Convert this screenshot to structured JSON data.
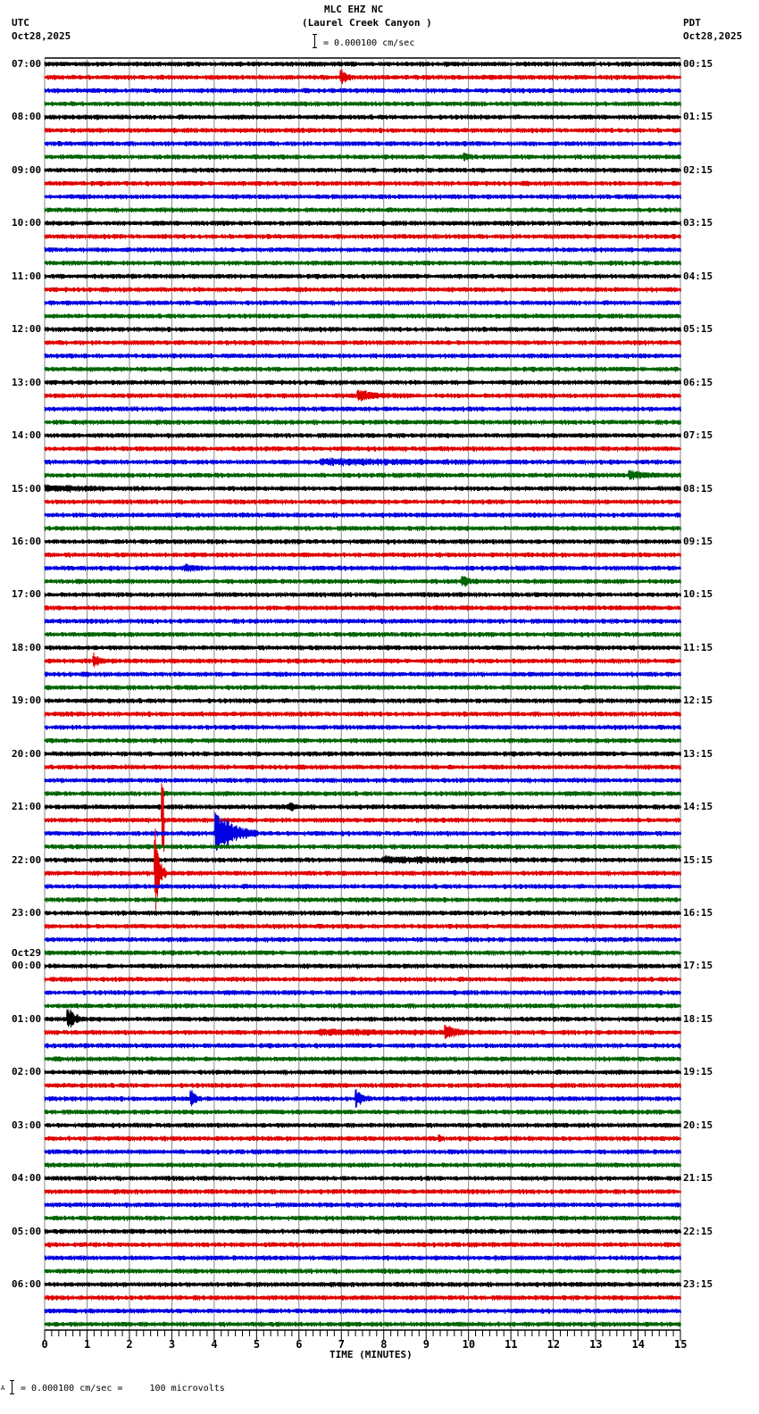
{
  "header": {
    "station": "MLC EHZ NC",
    "location": "(Laurel Creek Canyon )",
    "left_zone": "UTC",
    "left_date": "Oct28,2025",
    "right_zone": "PDT",
    "right_date": "Oct28,2025",
    "scale": "= 0.000100 cm/sec"
  },
  "footer": {
    "scale": "= 0.000100 cm/sec =     100 microvolts",
    "marker": "A"
  },
  "chart_data": {
    "type": "line",
    "title": "MLC EHZ NC (Laurel Creek Canyon )",
    "xlabel": "TIME (MINUTES)",
    "xlim": [
      0,
      15
    ],
    "x_ticks": [
      "0",
      "1",
      "2",
      "3",
      "4",
      "5",
      "6",
      "7",
      "8",
      "9",
      "10",
      "11",
      "12",
      "13",
      "14",
      "15"
    ],
    "traces_per_hour": 4,
    "trace_count": 96,
    "trace_colors": [
      "#000000",
      "#e00000",
      "#0000e0",
      "#006400"
    ],
    "left_labels": [
      "07:00",
      "08:00",
      "09:00",
      "10:00",
      "11:00",
      "12:00",
      "13:00",
      "14:00",
      "15:00",
      "16:00",
      "17:00",
      "18:00",
      "19:00",
      "20:00",
      "21:00",
      "22:00",
      "23:00",
      "00:00",
      "01:00",
      "02:00",
      "03:00",
      "04:00",
      "05:00",
      "06:00"
    ],
    "date_change_label": "Oct29",
    "right_labels": [
      "00:15",
      "01:15",
      "02:15",
      "03:15",
      "04:15",
      "05:15",
      "06:15",
      "07:15",
      "08:15",
      "09:15",
      "10:15",
      "11:15",
      "12:15",
      "13:15",
      "14:15",
      "15:15",
      "16:15",
      "17:15",
      "18:15",
      "19:15",
      "20:15",
      "21:15",
      "22:15",
      "23:15"
    ],
    "noise_level": 2.2,
    "events": [
      {
        "trace": 1,
        "minute": 7.0,
        "amplitude": 8,
        "duration": 0.3
      },
      {
        "trace": 7,
        "minute": 9.9,
        "amplitude": 4,
        "duration": 0.3
      },
      {
        "trace": 25,
        "minute": 7.4,
        "amplitude": 6,
        "duration": 1.0
      },
      {
        "trace": 30,
        "minute": 6.5,
        "amplitude": 3,
        "duration": 5.5
      },
      {
        "trace": 31,
        "minute": 13.8,
        "amplitude": 4,
        "duration": 1.2
      },
      {
        "trace": 32,
        "minute": 0.0,
        "amplitude": 3,
        "duration": 2.5
      },
      {
        "trace": 38,
        "minute": 3.3,
        "amplitude": 4,
        "duration": 0.6
      },
      {
        "trace": 39,
        "minute": 9.85,
        "amplitude": 7,
        "duration": 0.4
      },
      {
        "trace": 45,
        "minute": 1.15,
        "amplitude": 8,
        "duration": 0.3
      },
      {
        "trace": 56,
        "minute": 5.8,
        "amplitude": 5,
        "duration": 0.2
      },
      {
        "trace": 57,
        "minute": 2.77,
        "amplitude": 60,
        "duration": 0.05
      },
      {
        "trace": 58,
        "minute": 4.05,
        "amplitude": 30,
        "duration": 1.0
      },
      {
        "trace": 60,
        "minute": 8.0,
        "amplitude": 3,
        "duration": 4.8
      },
      {
        "trace": 61,
        "minute": 2.62,
        "amplitude": 60,
        "duration": 0.25
      },
      {
        "trace": 72,
        "minute": 0.55,
        "amplitude": 16,
        "duration": 0.4
      },
      {
        "trace": 73,
        "minute": 9.45,
        "amplitude": 10,
        "duration": 0.6
      },
      {
        "trace": 73,
        "minute": 6.5,
        "amplitude": 2.5,
        "duration": 4.5
      },
      {
        "trace": 78,
        "minute": 3.45,
        "amplitude": 12,
        "duration": 0.25
      },
      {
        "trace": 78,
        "minute": 7.35,
        "amplitude": 12,
        "duration": 0.35
      },
      {
        "trace": 81,
        "minute": 9.3,
        "amplitude": 5,
        "duration": 0.1
      }
    ]
  }
}
